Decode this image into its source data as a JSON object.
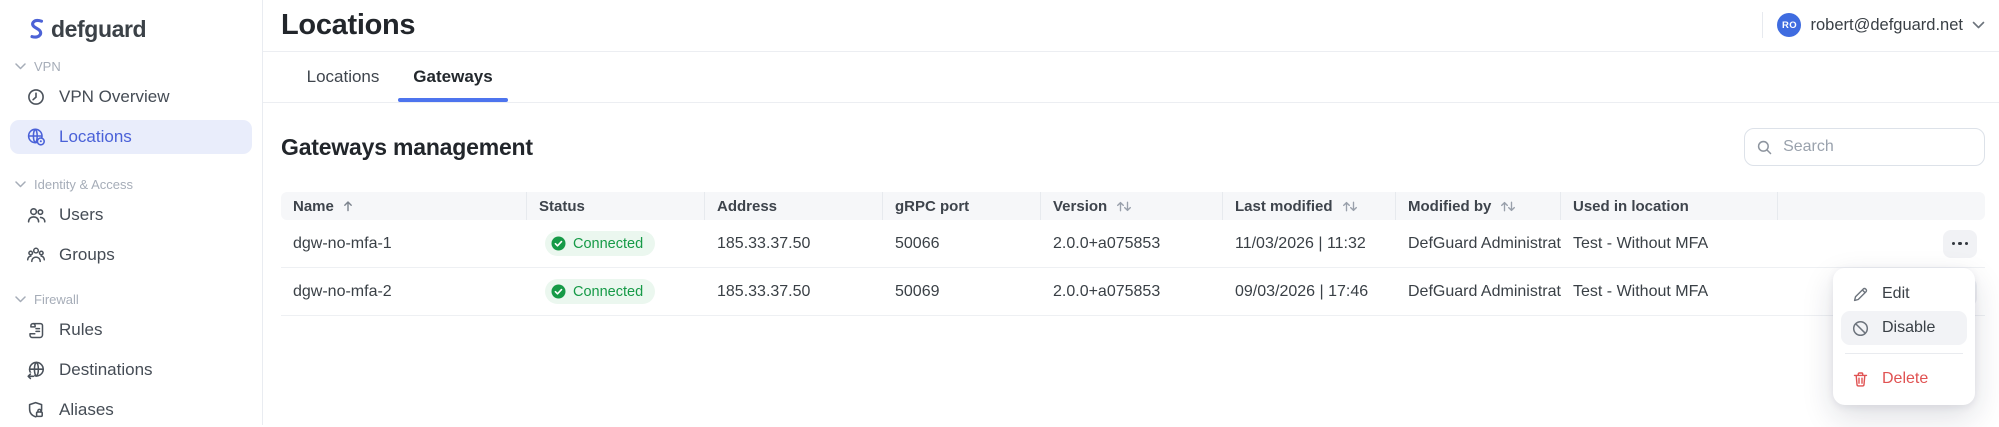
{
  "brand": {
    "name": "defguard"
  },
  "sidebar": {
    "sections": [
      {
        "label": "VPN",
        "items": [
          {
            "label": "VPN Overview",
            "icon": "clock-icon",
            "active": false
          },
          {
            "label": "Locations",
            "icon": "globe-pin-icon",
            "active": true
          }
        ]
      },
      {
        "label": "Identity & Access",
        "items": [
          {
            "label": "Users",
            "icon": "users-icon",
            "active": false
          },
          {
            "label": "Groups",
            "icon": "groups-icon",
            "active": false
          }
        ]
      },
      {
        "label": "Firewall",
        "items": [
          {
            "label": "Rules",
            "icon": "scroll-icon",
            "active": false
          },
          {
            "label": "Destinations",
            "icon": "globe-arrow-icon",
            "active": false
          },
          {
            "label": "Aliases",
            "icon": "shield-lock-icon",
            "active": false
          }
        ]
      }
    ]
  },
  "header": {
    "title": "Locations",
    "user": {
      "initials": "RO",
      "email": "robert@defguard.net"
    }
  },
  "tabs": [
    {
      "label": "Locations",
      "active": false
    },
    {
      "label": "Gateways",
      "active": true
    }
  ],
  "content": {
    "heading": "Gateways management",
    "search_placeholder": "Search",
    "table": {
      "columns": [
        {
          "label": "Name",
          "sort": "asc"
        },
        {
          "label": "Status",
          "sort": "none"
        },
        {
          "label": "Address",
          "sort": "none"
        },
        {
          "label": "gRPC port",
          "sort": "none"
        },
        {
          "label": "Version",
          "sort": "both"
        },
        {
          "label": "Last modified",
          "sort": "both"
        },
        {
          "label": "Modified by",
          "sort": "both"
        },
        {
          "label": "Used in location",
          "sort": "none"
        },
        {
          "label": "",
          "sort": "none"
        }
      ],
      "rows": [
        {
          "name": "dgw-no-mfa-1",
          "status": "Connected",
          "address": "185.33.37.50",
          "grpc_port": "50066",
          "version": "2.0.0+a075853",
          "last_modified": "11/03/2026 | 11:32",
          "modified_by": "DefGuard Administrat…",
          "used_in_location": "Test - Without MFA"
        },
        {
          "name": "dgw-no-mfa-2",
          "status": "Connected",
          "address": "185.33.37.50",
          "grpc_port": "50069",
          "version": "2.0.0+a075853",
          "last_modified": "09/03/2026 | 17:46",
          "modified_by": "DefGuard Administrat…",
          "used_in_location": "Test - Without MFA"
        }
      ]
    }
  },
  "context_menu": {
    "items": [
      {
        "label": "Edit",
        "icon": "pencil-icon",
        "state": "normal"
      },
      {
        "label": "Disable",
        "icon": "prohibit-icon",
        "state": "hovered"
      },
      {
        "label": "Delete",
        "icon": "trash-icon",
        "state": "danger"
      }
    ]
  },
  "colors": {
    "accent_blue": "#4d74ee",
    "sidebar_active_blue": "#4a61d8",
    "sidebar_active_bg": "#e9edfb",
    "avatar_blue": "#3f6ce0",
    "success_green": "#169a47",
    "success_bg": "#ebf7ef",
    "danger_red": "#e05252",
    "header_bg": "#f6f7f9",
    "border": "#eceef2"
  }
}
